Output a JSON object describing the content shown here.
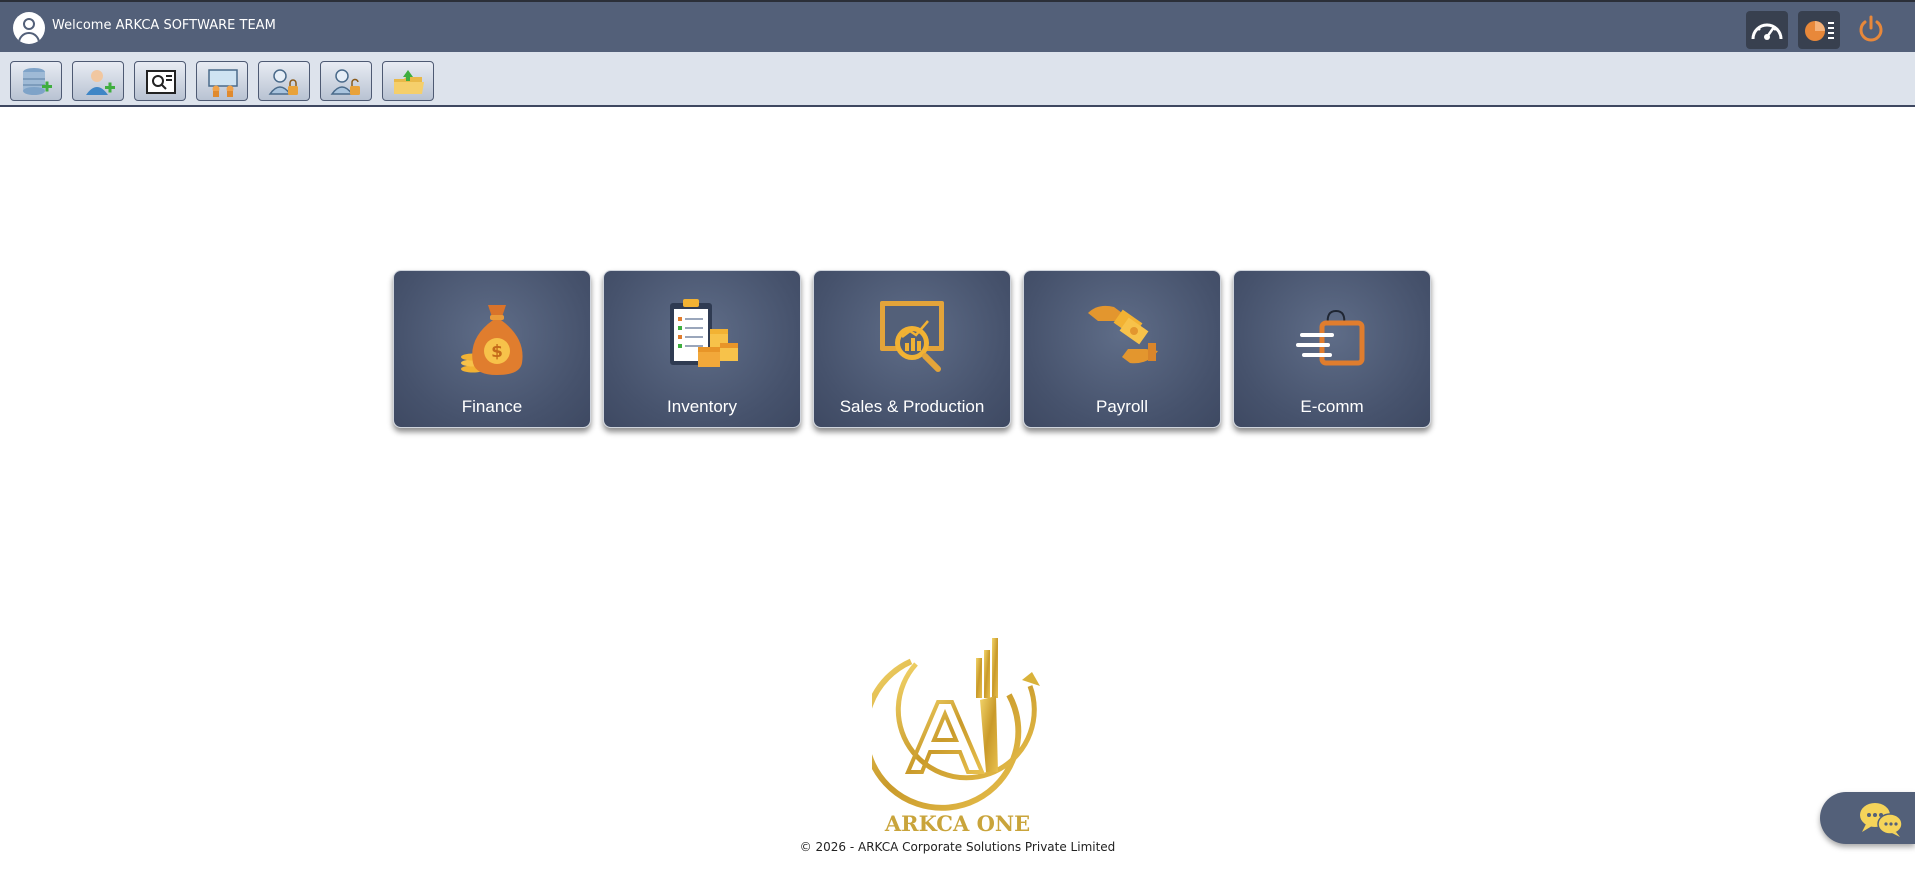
{
  "header": {
    "welcome_text": "Welcome ARKCA SOFTWARE TEAM",
    "icons": [
      "user-avatar-icon",
      "dashboard-gauge-icon",
      "report-chart-icon",
      "power-icon"
    ]
  },
  "toolbar": {
    "buttons": [
      {
        "icon": "database-add-icon"
      },
      {
        "icon": "user-add-icon"
      },
      {
        "icon": "document-search-icon"
      },
      {
        "icon": "presentation-board-icon"
      },
      {
        "icon": "user-lock-icon"
      },
      {
        "icon": "user-lock-alt-icon"
      },
      {
        "icon": "folder-upload-icon"
      }
    ]
  },
  "modules": [
    {
      "label": "Finance",
      "icon": "money-bag-icon"
    },
    {
      "label": "Inventory",
      "icon": "clipboard-boxes-icon"
    },
    {
      "label": "Sales & Production",
      "icon": "chart-magnifier-icon"
    },
    {
      "label": "Payroll",
      "icon": "hand-money-icon"
    },
    {
      "label": "E-comm",
      "icon": "shopping-bag-icon"
    }
  ],
  "footer": {
    "logo_text": "ARKCA ONE",
    "copyright": "© 2026 - ARKCA Corporate Solutions Private Limited"
  },
  "chat": {
    "icon": "chat-bubbles-icon"
  },
  "colors": {
    "header_bg": "#536079",
    "toolbar_bg": "#dde3ec",
    "accent_orange": "#e8883a",
    "logo_gold": "#c9a43b"
  }
}
